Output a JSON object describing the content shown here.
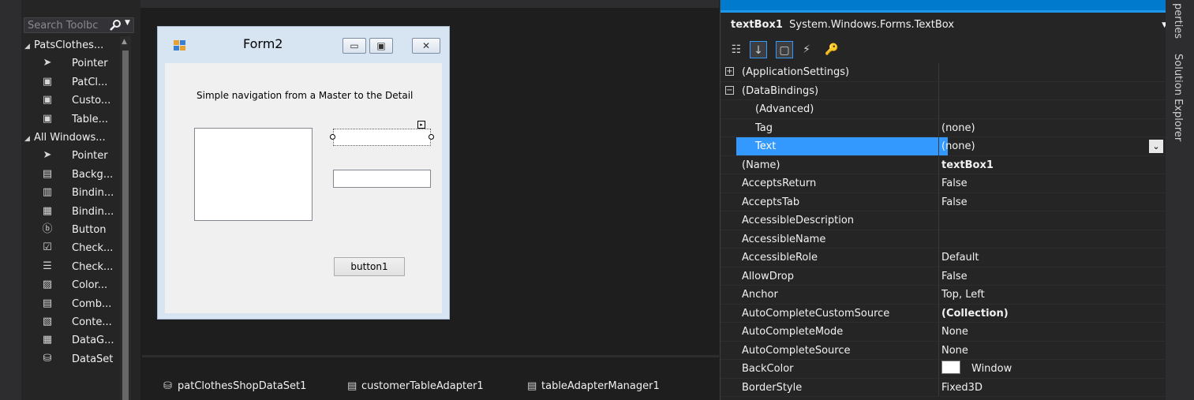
{
  "toolbox": {
    "search_placeholder": "Search Toolbc",
    "categories": [
      {
        "label": "PatsClothes...",
        "items": [
          {
            "label": "Pointer",
            "icon": "pointer-icon"
          },
          {
            "label": "PatCl...",
            "icon": "component-icon"
          },
          {
            "label": "Custo...",
            "icon": "component-icon"
          },
          {
            "label": "Table...",
            "icon": "component-icon"
          }
        ]
      },
      {
        "label": "All Windows...",
        "items": [
          {
            "label": "Pointer",
            "icon": "pointer-icon"
          },
          {
            "label": "Backg...",
            "icon": "backgroundworker-icon"
          },
          {
            "label": "Bindin...",
            "icon": "bindingnavigator-icon"
          },
          {
            "label": "Bindin...",
            "icon": "bindingsource-icon"
          },
          {
            "label": "Button",
            "icon": "button-icon"
          },
          {
            "label": "Check...",
            "icon": "checkbox-icon"
          },
          {
            "label": "Check...",
            "icon": "checkedlistbox-icon"
          },
          {
            "label": "Color...",
            "icon": "colordialog-icon"
          },
          {
            "label": "Comb...",
            "icon": "combobox-icon"
          },
          {
            "label": "Conte...",
            "icon": "contextmenu-icon"
          },
          {
            "label": "DataG...",
            "icon": "datagridview-icon"
          },
          {
            "label": "DataSet",
            "icon": "dataset-icon"
          }
        ]
      }
    ]
  },
  "form": {
    "title": "Form2",
    "caption": "Simple navigation from a Master to the Detail",
    "button1_label": "button1"
  },
  "tray": [
    {
      "label": "patClothesShopDataSet1",
      "icon": "dataset-icon"
    },
    {
      "label": "customerTableAdapter1",
      "icon": "tableadapter-icon"
    },
    {
      "label": "tableAdapterManager1",
      "icon": "tableadapter-icon"
    }
  ],
  "properties": {
    "object_name": "textBox1",
    "object_type": "System.Windows.Forms.TextBox",
    "rows": [
      {
        "name": "(ApplicationSettings)",
        "value": "",
        "expander": "+",
        "indent": false
      },
      {
        "name": "(DataBindings)",
        "value": "",
        "expander": "−",
        "indent": false
      },
      {
        "name": "(Advanced)",
        "value": "",
        "indent": true
      },
      {
        "name": "Tag",
        "value": "(none)",
        "indent": true
      },
      {
        "name": "Text",
        "value": "(none)",
        "indent": true,
        "selected": true
      },
      {
        "name": "(Name)",
        "value": "textBox1",
        "bold": true
      },
      {
        "name": "AcceptsReturn",
        "value": "False"
      },
      {
        "name": "AcceptsTab",
        "value": "False"
      },
      {
        "name": "AccessibleDescription",
        "value": ""
      },
      {
        "name": "AccessibleName",
        "value": ""
      },
      {
        "name": "AccessibleRole",
        "value": "Default"
      },
      {
        "name": "AllowDrop",
        "value": "False"
      },
      {
        "name": "Anchor",
        "value": "Top, Left"
      },
      {
        "name": "AutoCompleteCustomSource",
        "value": "(Collection)",
        "bold": true
      },
      {
        "name": "AutoCompleteMode",
        "value": "None"
      },
      {
        "name": "AutoCompleteSource",
        "value": "None"
      },
      {
        "name": "BackColor",
        "value": "Window",
        "swatch": "#ffffff"
      },
      {
        "name": "BorderStyle",
        "value": "Fixed3D"
      }
    ]
  },
  "side_tabs": {
    "properties": "perties",
    "solution_explorer": "Solution Explorer"
  },
  "colors": {
    "accent": "#007acc",
    "selection": "#3399ff",
    "form_background": "#d7e4f2"
  }
}
